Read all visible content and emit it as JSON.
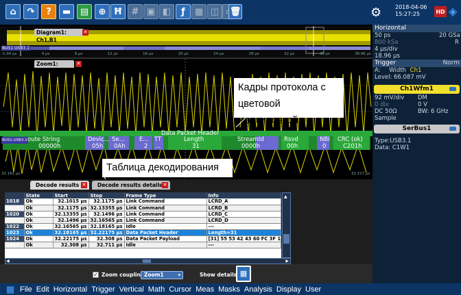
{
  "toolbar": {
    "icons": [
      "home-icon",
      "redo-icon",
      "help-icon",
      "open-folder-icon",
      "image-icon",
      "zoom-icon",
      "histogram-icon",
      "grid-icon",
      "mask-icon",
      "cursor-icon",
      "math-icon",
      "tile-icon",
      "delete-icon"
    ],
    "date": "2018-04-06",
    "time": "15:27:25",
    "hd_badge": "HD"
  },
  "right_panel": {
    "horizontal": {
      "title": "Horizontal",
      "scale": "50 ps",
      "rate": "20 GSa",
      "samples": "800 kSa",
      "resolution": "R",
      "time_div": "4 µs/div",
      "position": "18.96 µs"
    },
    "trigger": {
      "title": "Trigger",
      "mode": "Norm",
      "source_prefix": "A:",
      "type": "Width",
      "channel": "Ch1",
      "level": "Level: 66.087 mV"
    },
    "ch1": {
      "title": "Ch1Wfm1",
      "vdiv": "92 mV/div",
      "mode": "DM",
      "offset": "0 div",
      "offset_v": "0 V",
      "coupling": "DC 50Ω",
      "bandwidth": "BW: 6 GHz",
      "acq": "Sample"
    },
    "serbus": {
      "title": "SerBus1",
      "type": "Type:USB3.1",
      "data": "Data: C1W1"
    }
  },
  "diagram": {
    "diagram1_title": "Diagram1: Ch1,B1",
    "zoom1_title": "Zoom1: Ch1,B1",
    "bus_label_overview": "BUS1:USB3.1",
    "bus_label_zoom": "BUS1:USB3.1",
    "overview_ticks": [
      "-1.04 µs",
      "4 µs",
      "8 µs",
      "12 µs",
      "16 µs",
      "20 µs",
      "24 µs",
      "28 µs",
      "32 µs",
      "36 µs",
      "38.96 µs"
    ],
    "zoom_left": "32.161 µs",
    "zoom_right": "32.217 µs",
    "packet_header": "Data Packet Header",
    "fields": [
      {
        "name": "oute String",
        "value": "00000h"
      },
      {
        "name": "Devic...",
        "value": "05h"
      },
      {
        "name": "Se...",
        "value": "0Ah"
      },
      {
        "name": "E...",
        "value": "2"
      },
      {
        "name": "TT",
        "value": "..."
      },
      {
        "name": "Length",
        "value": "31"
      },
      {
        "name": "StreamId",
        "value": "0000h"
      },
      {
        "name": "Rsvd",
        "value": "00h"
      },
      {
        "name": "NBI",
        "value": "0"
      },
      {
        "name": "CRC (ok)",
        "value": "C201h"
      }
    ]
  },
  "callouts": {
    "frames": "Кадры протокола с цветовой маркировкой",
    "frames_l1": "Кадры протокола с",
    "frames_l2": "цветовой маркировкой",
    "table": "Таблица декодирования"
  },
  "decode": {
    "tab1": "Decode results B 1",
    "tab2": "Decode results details B 1",
    "columns": [
      "",
      "State",
      "Start",
      "Stop",
      "Frame Type",
      "Info"
    ],
    "rows": [
      {
        "n": "1018",
        "state": "Ok",
        "start": "32.1015 µs",
        "stop": "32.1175 µs",
        "type": "Link Command",
        "info": "LCRD_A",
        "sel": false
      },
      {
        "n": "1019",
        "state": "Ok",
        "start": "32.1175 µs",
        "stop": "32.13355 µs",
        "type": "Link Command",
        "info": "LCRD_B",
        "sel": false
      },
      {
        "n": "1020",
        "state": "Ok",
        "start": "32.13355 µs",
        "stop": "32.1496 µs",
        "type": "Link Command",
        "info": "LCRD_C",
        "sel": false
      },
      {
        "n": "1021",
        "state": "Ok",
        "start": "32.1496 µs",
        "stop": "32.16565 µs",
        "type": "Link Command",
        "info": "LCRD_D",
        "sel": false
      },
      {
        "n": "1022",
        "state": "Ok",
        "start": "32.16565 µs",
        "stop": "32.18165 µs",
        "type": "Idle",
        "info": "---",
        "sel": false
      },
      {
        "n": "1023",
        "state": "Ok",
        "start": "32.18165 µs",
        "stop": "32.22175 µs",
        "type": "Data Packet Header",
        "info": "Length=31",
        "sel": true
      },
      {
        "n": "1024",
        "state": "Ok",
        "start": "32.22175 µs",
        "stop": "32.308 µs",
        "type": "Data Packet Payload",
        "info": "[31] 55 53 42 43 60 FC 3F 1...",
        "sel": false
      },
      {
        "n": "1025",
        "state": "Ok",
        "start": "32.308 µs",
        "stop": "32.711 µs",
        "type": "Idle",
        "info": "---",
        "sel": false
      }
    ],
    "zoom_coupling_label": "Zoom coupling",
    "zoom_selected": "Zoom1",
    "show_details_label": "Show details"
  },
  "menu": [
    "File",
    "Edit",
    "Horizontal",
    "Trigger",
    "Vertical",
    "Math",
    "Cursor",
    "Meas",
    "Masks",
    "Analysis",
    "Display",
    "User"
  ],
  "colors": {
    "toolbar_bg": "#0c3566",
    "waveform": "#e8e000",
    "bus_green": "#1f8a2c",
    "selection": "#1b83dc"
  }
}
